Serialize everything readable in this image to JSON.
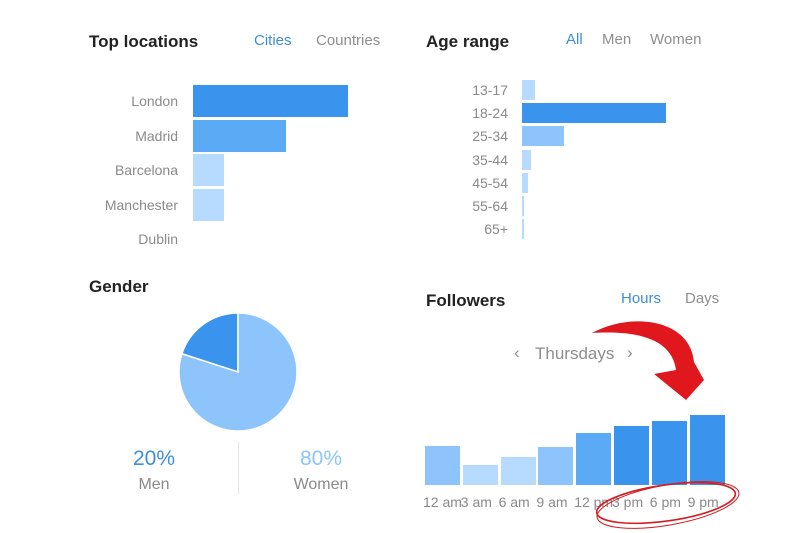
{
  "colors": {
    "accent": "#3d8fd6",
    "bar_dark": "#3a94ee",
    "bar_mid": "#5aaaf5",
    "bar_light": "#8cc4fb",
    "bar_pale": "#b7daff",
    "annotation": "#e0181e"
  },
  "top_locations": {
    "title": "Top locations",
    "tabs": [
      {
        "label": "Cities",
        "active": true
      },
      {
        "label": "Countries",
        "active": false
      }
    ]
  },
  "age_range": {
    "title": "Age range",
    "tabs": [
      {
        "label": "All",
        "active": true
      },
      {
        "label": "Men",
        "active": false
      },
      {
        "label": "Women",
        "active": false
      }
    ]
  },
  "gender": {
    "title": "Gender",
    "men": {
      "percent": "20%",
      "label": "Men"
    },
    "women": {
      "percent": "80%",
      "label": "Women"
    }
  },
  "followers": {
    "title": "Followers",
    "tabs": [
      {
        "label": "Hours",
        "active": true
      },
      {
        "label": "Days",
        "active": false
      }
    ],
    "day_selector": {
      "prev": "‹",
      "label": "Thursdays",
      "next": "›"
    },
    "annotation": "red arrow pointing to circled 3 pm – 9 pm bars"
  },
  "chart_data": [
    {
      "type": "bar",
      "orientation": "horizontal",
      "title": "Top locations",
      "categories": [
        "London",
        "Madrid",
        "Barcelona",
        "Manchester",
        "Dublin"
      ],
      "values": [
        100,
        60,
        20,
        20,
        0
      ],
      "xlim": [
        0,
        100
      ]
    },
    {
      "type": "bar",
      "orientation": "horizontal",
      "title": "Age range",
      "categories": [
        "13-17",
        "18-24",
        "25-34",
        "35-44",
        "45-54",
        "55-64",
        "65+"
      ],
      "values": [
        9,
        100,
        29,
        6,
        4,
        1,
        1
      ],
      "xlim": [
        0,
        100
      ]
    },
    {
      "type": "pie",
      "title": "Gender",
      "labels": [
        "Men",
        "Women"
      ],
      "values": [
        20,
        80
      ]
    },
    {
      "type": "bar",
      "title": "Followers",
      "categories": [
        "12 am",
        "3 am",
        "6 am",
        "9 am",
        "12 pm",
        "3 pm",
        "6 pm",
        "9 pm"
      ],
      "values": [
        56,
        28,
        40,
        54,
        74,
        85,
        91,
        100
      ],
      "ylim": [
        0,
        100
      ]
    }
  ]
}
